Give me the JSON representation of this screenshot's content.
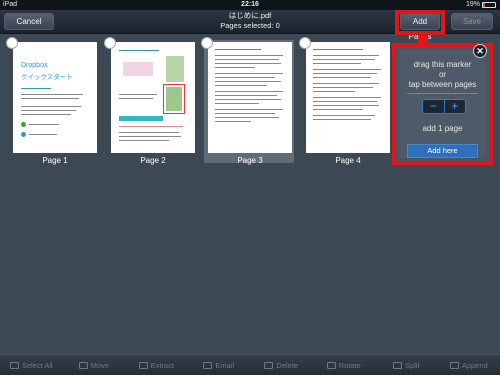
{
  "status_bar": {
    "device": "iPad",
    "time": "22:16",
    "battery": "19%"
  },
  "nav": {
    "cancel_label": "Cancel",
    "file_name": "はじめに.pdf",
    "selection_text": "Pages selected: 0",
    "add_pages_label": "Add Pages",
    "save_label": "Save"
  },
  "pages": [
    {
      "label": "Page 1",
      "heading_en": "Dropbox",
      "heading_ja": "クイックスタート"
    },
    {
      "label": "Page 2"
    },
    {
      "label": "Page 3"
    },
    {
      "label": "Page 4"
    }
  ],
  "marker": {
    "line1": "drag this marker",
    "line2": "or",
    "line3": "tap between pages",
    "minus": "−",
    "plus": "+",
    "count_text": "add 1 page",
    "add_here_label": "Add here",
    "close": "✕"
  },
  "toolbar": [
    {
      "label": "Select All",
      "icon": "select-all-icon"
    },
    {
      "label": "Move",
      "icon": "move-icon"
    },
    {
      "label": "Extract",
      "icon": "extract-icon"
    },
    {
      "label": "Email",
      "icon": "email-icon"
    },
    {
      "label": "Delete",
      "icon": "trash-icon"
    },
    {
      "label": "Rotate",
      "icon": "rotate-icon"
    },
    {
      "label": "Split",
      "icon": "split-icon"
    },
    {
      "label": "Append",
      "icon": "append-icon"
    }
  ],
  "colors": {
    "highlight": "#e0161d",
    "accent": "#2e6fb9",
    "background": "#3d4855"
  }
}
